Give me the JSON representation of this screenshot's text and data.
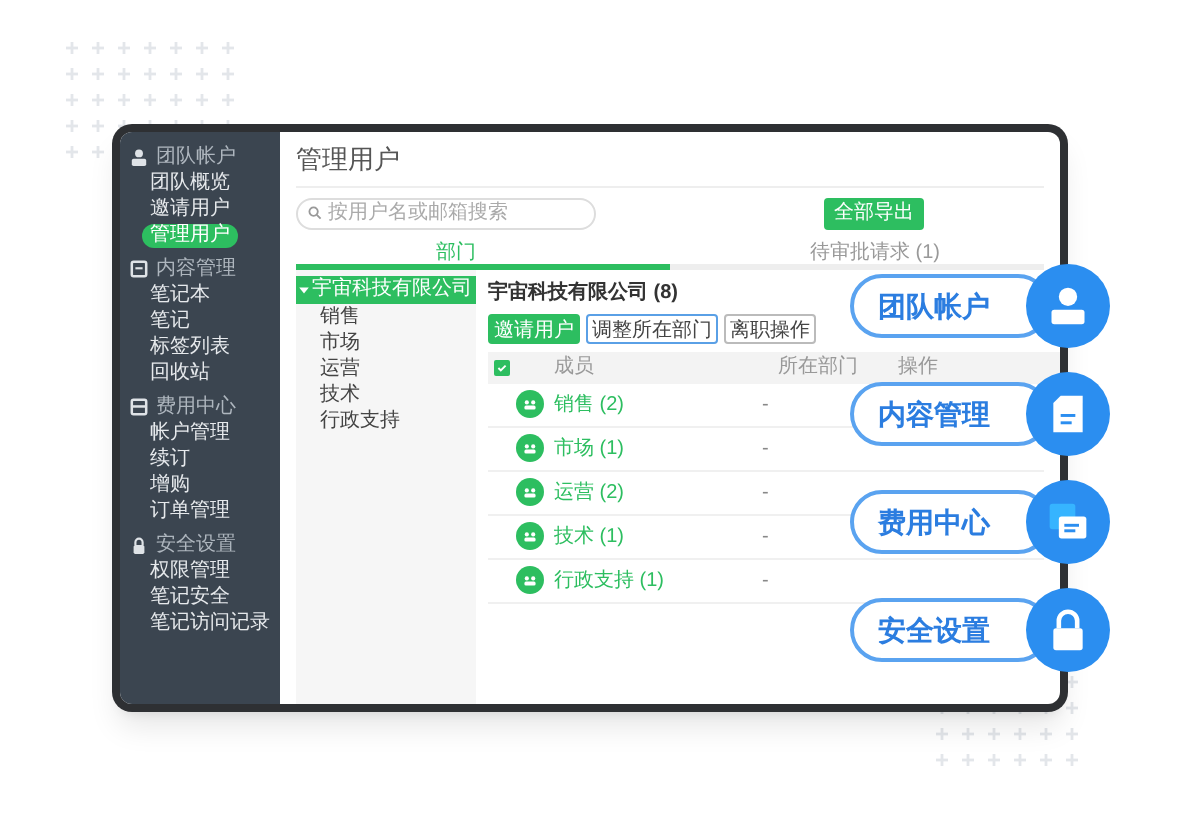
{
  "sidebar": {
    "groups": [
      {
        "kind": "team",
        "title": "团队帐户",
        "items": [
          {
            "label": "团队概览",
            "selected": false
          },
          {
            "label": "邀请用户",
            "selected": false
          },
          {
            "label": "管理用户",
            "selected": true
          }
        ]
      },
      {
        "kind": "content",
        "title": "内容管理",
        "items": [
          {
            "label": "笔记本",
            "selected": false
          },
          {
            "label": "笔记",
            "selected": false
          },
          {
            "label": "标签列表",
            "selected": false
          },
          {
            "label": "回收站",
            "selected": false
          }
        ]
      },
      {
        "kind": "billing",
        "title": "费用中心",
        "items": [
          {
            "label": "帐户管理",
            "selected": false
          },
          {
            "label": "续订",
            "selected": false
          },
          {
            "label": "增购",
            "selected": false
          },
          {
            "label": "订单管理",
            "selected": false
          }
        ]
      },
      {
        "kind": "security",
        "title": "安全设置",
        "items": [
          {
            "label": "权限管理",
            "selected": false
          },
          {
            "label": "笔记安全",
            "selected": false
          },
          {
            "label": "笔记访问记录",
            "selected": false
          }
        ]
      }
    ]
  },
  "page": {
    "title": "管理用户",
    "search": {
      "placeholder": "按用户名或邮箱搜索"
    },
    "export_button": "全部导出"
  },
  "tabs": [
    {
      "label": "部门",
      "selected": true
    },
    {
      "label": "待审批请求 (1)",
      "selected": false
    }
  ],
  "tree": [
    {
      "label": "宇宙科技有限公司",
      "selected": true,
      "expanded": true,
      "children": [
        {
          "label": "销售",
          "selected": false
        },
        {
          "label": "市场",
          "selected": false
        },
        {
          "label": "运营",
          "selected": false
        },
        {
          "label": "技术",
          "selected": false
        },
        {
          "label": "行政支持",
          "selected": false
        }
      ]
    }
  ],
  "department": {
    "heading": "宇宙科技有限公司 (8)",
    "actions": [
      {
        "label": "邀请用户",
        "kind": "primary"
      },
      {
        "label": "调整所在部门",
        "kind": "focused"
      },
      {
        "label": "离职操作",
        "kind": "plain"
      }
    ]
  },
  "table": {
    "select_all": {
      "checked": true
    },
    "columns": [
      "成员",
      "所在部门",
      "操作"
    ],
    "rows": [
      {
        "member": "销售 (2)",
        "department": "-"
      },
      {
        "member": "市场 (1)",
        "department": "-"
      },
      {
        "member": "运营 (2)",
        "department": "-"
      },
      {
        "member": "技术 (1)",
        "department": "-"
      },
      {
        "member": "行政支持 (1)",
        "department": "-"
      }
    ]
  },
  "callouts": [
    {
      "kind": "team",
      "label": "团队帐户"
    },
    {
      "kind": "content",
      "label": "内容管理"
    },
    {
      "kind": "billing",
      "label": "费用中心"
    },
    {
      "kind": "security",
      "label": "安全设置"
    }
  ]
}
